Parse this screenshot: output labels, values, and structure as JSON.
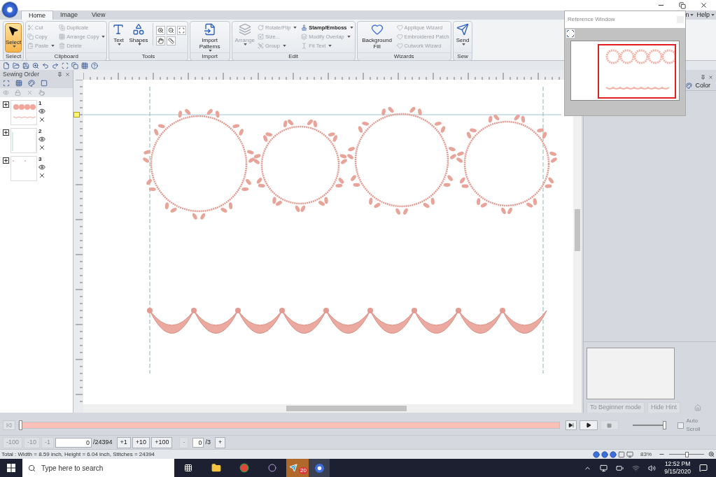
{
  "tabs": [
    {
      "label": "Home",
      "selected": true
    },
    {
      "label": "Image",
      "selected": false
    },
    {
      "label": "View",
      "selected": false
    }
  ],
  "menu": {
    "cut_label": "n",
    "help": "Help"
  },
  "ribbon": [
    {
      "kind": "select",
      "title": "Select",
      "items": [
        {
          "kind": "tool",
          "label": "Select",
          "disabled": false,
          "dropdown": true
        }
      ]
    },
    {
      "kind": "clipboard",
      "title": "Clipboard",
      "items": [
        {
          "kind": "small",
          "label": "Cut",
          "disabled": true,
          "dropdown": false
        },
        {
          "kind": "small",
          "label": "Copy",
          "disabled": true,
          "dropdown": false
        },
        {
          "kind": "small",
          "label": "Paste",
          "disabled": true,
          "dropdown": true
        },
        {
          "kind": "small",
          "label": "Duplicate",
          "disabled": true,
          "dropdown": false
        },
        {
          "kind": "small",
          "label": "Arrange Copy",
          "disabled": true,
          "dropdown": true
        },
        {
          "kind": "small",
          "label": "Delete",
          "disabled": true,
          "dropdown": false
        }
      ]
    },
    {
      "kind": "tools",
      "title": "Tools",
      "items": [
        {
          "kind": "large",
          "label": "Text",
          "disabled": false,
          "dropdown": true
        },
        {
          "kind": "large",
          "label": "Shapes",
          "disabled": false,
          "dropdown": true
        }
      ]
    },
    {
      "kind": "import",
      "title": "Import",
      "items": [
        {
          "kind": "large",
          "label": "Import Patterns",
          "disabled": false,
          "dropdown": true
        }
      ]
    },
    {
      "kind": "edit",
      "title": "Edit",
      "items": [
        {
          "kind": "large",
          "label": "Arrange",
          "disabled": true,
          "dropdown": true
        },
        {
          "kind": "small",
          "label": "Rotate/Flip",
          "disabled": true,
          "dropdown": true
        },
        {
          "kind": "small",
          "label": "Size...",
          "disabled": true,
          "dropdown": false
        },
        {
          "kind": "small",
          "label": "Group",
          "disabled": true,
          "dropdown": true
        },
        {
          "kind": "small",
          "label": "Stamp/Emboss",
          "disabled": false,
          "dropdown": true
        },
        {
          "kind": "small",
          "label": "Modify Overlap",
          "disabled": true,
          "dropdown": true
        },
        {
          "kind": "small",
          "label": "Fit Text",
          "disabled": true,
          "dropdown": true
        }
      ]
    },
    {
      "kind": "wizards",
      "title": "Wizards",
      "items": [
        {
          "kind": "large",
          "label": "Background Fill",
          "disabled": false,
          "dropdown": false
        },
        {
          "kind": "small",
          "label": "Applique Wizard",
          "disabled": true,
          "dropdown": false
        },
        {
          "kind": "small",
          "label": "Embroidered Patch",
          "disabled": true,
          "dropdown": false
        },
        {
          "kind": "small",
          "label": "Cutwork Wizard",
          "disabled": true,
          "dropdown": false
        }
      ]
    },
    {
      "kind": "sew",
      "title": "Sew",
      "items": [
        {
          "kind": "large",
          "label": "Send",
          "disabled": false,
          "dropdown": true
        }
      ]
    }
  ],
  "sewing_order": {
    "title": "Sewing Order",
    "items": [
      {
        "number": "1",
        "kind": "design"
      },
      {
        "number": "2",
        "kind": "lines"
      },
      {
        "number": "3",
        "kind": "dots"
      }
    ]
  },
  "reference_window": {
    "title": "Reference Window"
  },
  "right_panel": {
    "color_tab": "Color",
    "buttons": [
      {
        "label": "To Beginner mode",
        "disabled": true
      },
      {
        "label": "Hide Hint",
        "disabled": true
      }
    ]
  },
  "playback": {
    "progress": {
      "level": 0.0
    },
    "speed": {
      "level": 1.0
    },
    "auto_scroll": {
      "label": "Auto Scroll",
      "checked": false,
      "disabled": true
    }
  },
  "stepper": {
    "back_buttons": [
      {
        "label": "-100",
        "disabled": true
      },
      {
        "label": "-10",
        "disabled": true
      },
      {
        "label": "-1",
        "disabled": true
      }
    ],
    "stitch_value": "0",
    "stitch_total": "/24394",
    "forward_buttons": [
      {
        "label": "+1",
        "disabled": false
      },
      {
        "label": "+10",
        "disabled": false
      },
      {
        "label": "+100",
        "disabled": false
      }
    ],
    "frame_minus": {
      "label": "-",
      "disabled": true
    },
    "frame_value": "0",
    "frame_total": "/3",
    "frame_plus": {
      "label": "+",
      "disabled": false
    }
  },
  "status_bar": {
    "text": "Total : Width = 8.59 inch, Height = 6.04 inch, Stitches = 24394",
    "zoom": "83%",
    "zoom_slider": {
      "level": 0.5
    }
  },
  "taskbar": {
    "search_placeholder": "Type here to search",
    "badge": "20",
    "time": "12:52 PM",
    "date": "9/15/2020"
  }
}
